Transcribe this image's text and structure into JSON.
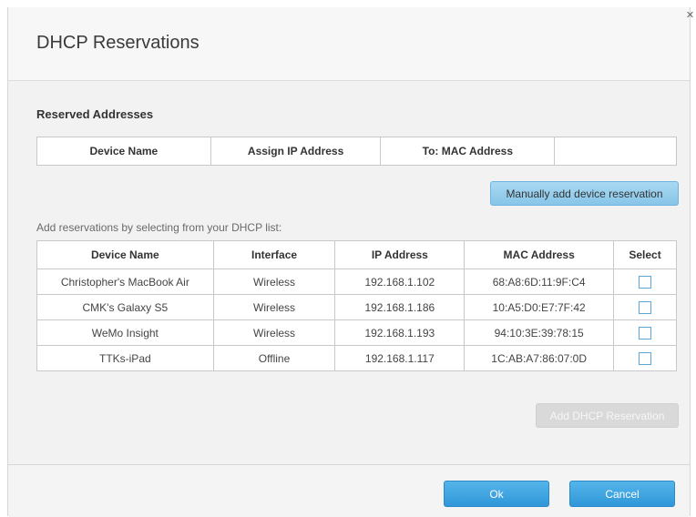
{
  "dialog": {
    "title": "DHCP Reservations",
    "close_icon": "close-icon"
  },
  "reserved": {
    "section_title": "Reserved Addresses",
    "headers": [
      "Device Name",
      "Assign IP Address",
      "To: MAC Address",
      ""
    ]
  },
  "manual_add_label": "Manually add device reservation",
  "hint": "Add reservations by selecting from your DHCP list:",
  "dhcp_list": {
    "headers": [
      "Device Name",
      "Interface",
      "IP Address",
      "MAC Address",
      "Select"
    ],
    "rows": [
      {
        "device": "Christopher's MacBook Air",
        "interface": "Wireless",
        "ip": "192.168.1.102",
        "mac": "68:A8:6D:11:9F:C4",
        "selected": false
      },
      {
        "device": "CMK's Galaxy S5",
        "interface": "Wireless",
        "ip": "192.168.1.186",
        "mac": "10:A5:D0:E7:7F:42",
        "selected": false
      },
      {
        "device": "WeMo Insight",
        "interface": "Wireless",
        "ip": "192.168.1.193",
        "mac": "94:10:3E:39:78:15",
        "selected": false
      },
      {
        "device": "TTKs-iPad",
        "interface": "Offline",
        "ip": "192.168.1.117",
        "mac": "1C:AB:A7:86:07:0D",
        "selected": false
      }
    ]
  },
  "add_dhcp_label": "Add DHCP Reservation",
  "footer": {
    "ok_label": "Ok",
    "cancel_label": "Cancel"
  },
  "colors": {
    "accent": "#2f97d8",
    "secondary_button": "#87c5e8",
    "disabled_button": "#d9d9d9"
  }
}
